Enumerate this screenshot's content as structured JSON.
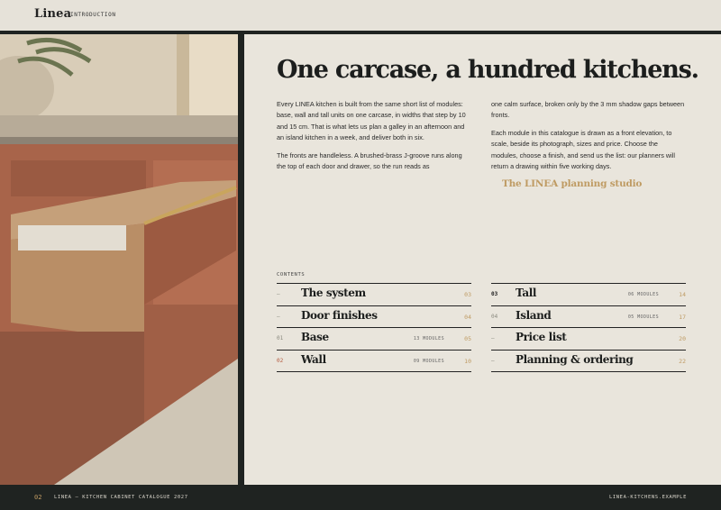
{
  "header": {
    "brand": "Linea",
    "section": "INTRODUCTION"
  },
  "photo": {
    "subject": "kitchen-drawer-photo"
  },
  "main": {
    "title": "One carcase, a hundred kitchens.",
    "paragraphs_left": [
      "Every LINEA kitchen is built from the same short list of modules: base, wall and tall units on one carcase, in widths that step by 10 and 15 cm. That is what lets us plan a galley in an afternoon and an island kitchen in a week, and deliver both in six.",
      "The fronts are handleless. A brushed-brass J-groove runs along the top of each door and drawer, so the run reads as"
    ],
    "paragraphs_right": [
      "one calm surface, broken only by the 3 mm shadow gaps between fronts.",
      "Each module in this catalogue is drawn as a front elevation, to scale, beside its photograph, sizes and price. Choose the modules, choose a finish, and send us the list: our planners will return a drawing within five working days."
    ],
    "signature": "The LINEA planning studio"
  },
  "contents": {
    "label": "CONTENTS",
    "left": [
      {
        "num": "–",
        "title": "The system",
        "count": "",
        "page": "03"
      },
      {
        "num": "–",
        "title": "Door finishes",
        "count": "",
        "page": "04"
      },
      {
        "num": "01",
        "title": "Base",
        "count": "13 MODULES",
        "page": "05"
      },
      {
        "num": "02",
        "title": "Wall",
        "count": "09 MODULES",
        "page": "10"
      }
    ],
    "right": [
      {
        "num": "03",
        "title": "Tall",
        "count": "06 MODULES",
        "page": "14"
      },
      {
        "num": "04",
        "title": "Island",
        "count": "05 MODULES",
        "page": "17"
      },
      {
        "num": "–",
        "title": "Price list",
        "count": "",
        "page": "20"
      },
      {
        "num": "–",
        "title": "Planning & ordering",
        "count": "",
        "page": "22"
      }
    ]
  },
  "footer": {
    "page": "02",
    "caption": "LINEA — KITCHEN CABINET CATALOGUE 2027",
    "url": "LINEA-KITCHENS.EXAMPLE"
  },
  "colors": {
    "accent_gold": "#bf9b63",
    "terracotta": "#b45a3f",
    "dark": "#1f2321",
    "paper": "#e9e5dc"
  }
}
